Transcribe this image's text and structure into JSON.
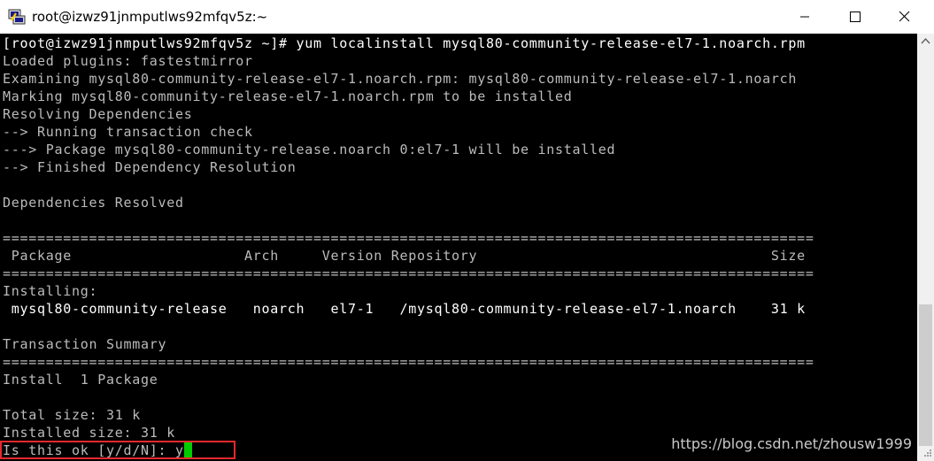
{
  "window": {
    "title": "root@izwz91jnmputlws92mfqv5z:~",
    "icons": {
      "app": "putty-icon",
      "minimize": "minimize-icon",
      "maximize": "maximize-icon",
      "close": "close-icon"
    }
  },
  "terminal": {
    "lines": [
      "[root@izwz91jnmputlws92mfqv5z ~]# yum localinstall mysql80-community-release-el7-1.noarch.rpm",
      "Loaded plugins: fastestmirror",
      "Examining mysql80-community-release-el7-1.noarch.rpm: mysql80-community-release-el7-1.noarch",
      "Marking mysql80-community-release-el7-1.noarch.rpm to be installed",
      "Resolving Dependencies",
      "--> Running transaction check",
      "---> Package mysql80-community-release.noarch 0:el7-1 will be installed",
      "--> Finished Dependency Resolution",
      "",
      "Dependencies Resolved",
      "",
      "==============================================================================================",
      " Package                    Arch     Version Repository                                  Size",
      "==============================================================================================",
      "Installing:",
      " mysql80-community-release   noarch   el7-1   /mysql80-community-release-el7-1.noarch    31 k",
      "",
      "Transaction Summary",
      "==============================================================================================",
      "Install  1 Package",
      "",
      "Total size: 31 k",
      "Installed size: 31 k"
    ],
    "prompt": "Is this ok [y/d/N]: ",
    "input_value": "y",
    "cursor_color": "#00cc00",
    "highlight_color": "#e8282e"
  },
  "watermark": "https://blog.csdn.net/zhousw1999",
  "colors": {
    "background": "#000000",
    "text": "#bbbbbb",
    "bright_text": "#ffffff"
  }
}
